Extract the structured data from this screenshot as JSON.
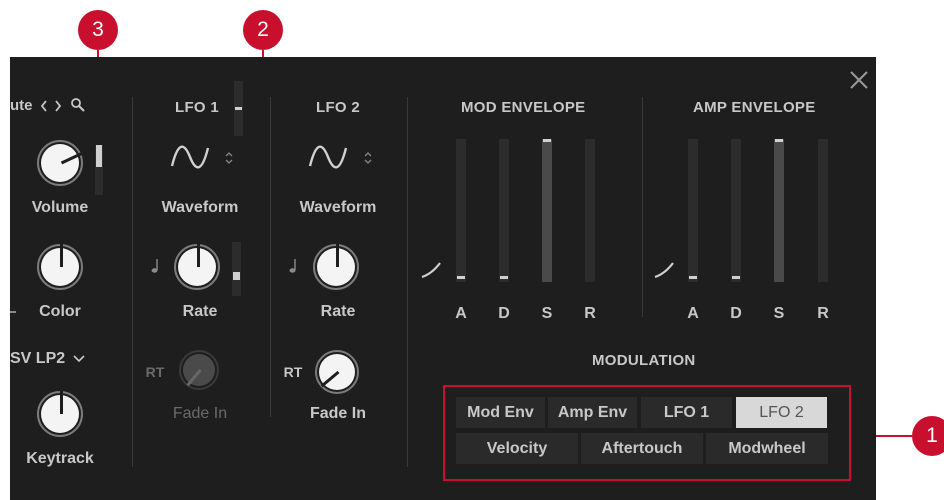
{
  "callouts": {
    "c1": "1",
    "c2": "2",
    "c3": "3"
  },
  "main": {
    "search_partial": "ute"
  },
  "left": {
    "volume": {
      "label": "Volume",
      "level": 0.72
    },
    "color": {
      "label": "Color",
      "level": 0.5
    },
    "filter_type": "SV LP2",
    "keytrack": {
      "label": "Keytrack",
      "level": 0.5
    }
  },
  "lfo1": {
    "title": "LFO 1",
    "waveform_label": "Waveform",
    "rate_label": "Rate",
    "rt_label": "RT",
    "fade_in_label": "Fade In"
  },
  "lfo2": {
    "title": "LFO 2",
    "waveform_label": "Waveform",
    "rate_label": "Rate",
    "rt_label": "RT",
    "fade_in_label": "Fade In"
  },
  "mod_envelope": {
    "title": "MOD ENVELOPE",
    "sliders": [
      {
        "label": "A",
        "level": 0.04
      },
      {
        "label": "D",
        "level": 0.04
      },
      {
        "label": "S",
        "level": 1.0
      },
      {
        "label": "R",
        "level": 0.0
      }
    ]
  },
  "amp_envelope": {
    "title": "AMP ENVELOPE",
    "sliders": [
      {
        "label": "A",
        "level": 0.04
      },
      {
        "label": "D",
        "level": 0.04
      },
      {
        "label": "S",
        "level": 1.0
      },
      {
        "label": "R",
        "level": 0.0
      }
    ]
  },
  "modulation": {
    "title": "MODULATION",
    "sources_row1": [
      "Mod Env",
      "Amp Env",
      "LFO 1",
      "LFO 2"
    ],
    "sources_row2": [
      "Velocity",
      "Aftertouch",
      "Modwheel"
    ],
    "selected": "LFO 2"
  },
  "icons": {
    "close": "close-icon",
    "search": "search-icon",
    "nav": "chevron-left-right-icon",
    "waveform": "sine-wave-icon",
    "note": "note-icon"
  },
  "colors": {
    "callout": "#c8102e",
    "panel": "#1e1e1e",
    "selected_chip": "#d8d8d8"
  }
}
